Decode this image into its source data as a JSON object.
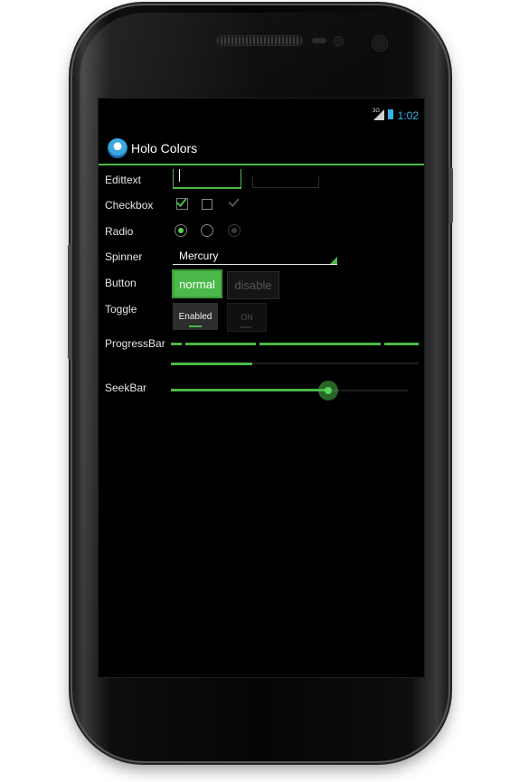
{
  "status": {
    "network": "3G",
    "time": "1:02"
  },
  "app": {
    "title": "Holo Colors",
    "accent": "#4bb849",
    "status_accent": "#33b5e5"
  },
  "rows": {
    "edittext": "Edittext",
    "checkbox": "Checkbox",
    "radio": "Radio",
    "spinner": "Spinner",
    "button": "Button",
    "toggle": "Toggle",
    "progressbar": "ProgressBar",
    "seekbar": "SeekBar"
  },
  "spinner": {
    "value": "Mercury"
  },
  "buttons": {
    "normal": "normal",
    "disable": "disable"
  },
  "toggles": {
    "enabled": "Enabled",
    "on": "ON"
  },
  "checkboxes": [
    {
      "state": "checked",
      "enabled": true
    },
    {
      "state": "unchecked",
      "enabled": true
    },
    {
      "state": "checked",
      "enabled": false
    }
  ],
  "radios": [
    {
      "state": "selected",
      "enabled": true
    },
    {
      "state": "unselected",
      "enabled": true
    },
    {
      "state": "selected",
      "enabled": false
    }
  ],
  "progress": {
    "determinate_fraction": 0.33,
    "indeterminate": true
  },
  "seekbar_fraction": 0.67
}
